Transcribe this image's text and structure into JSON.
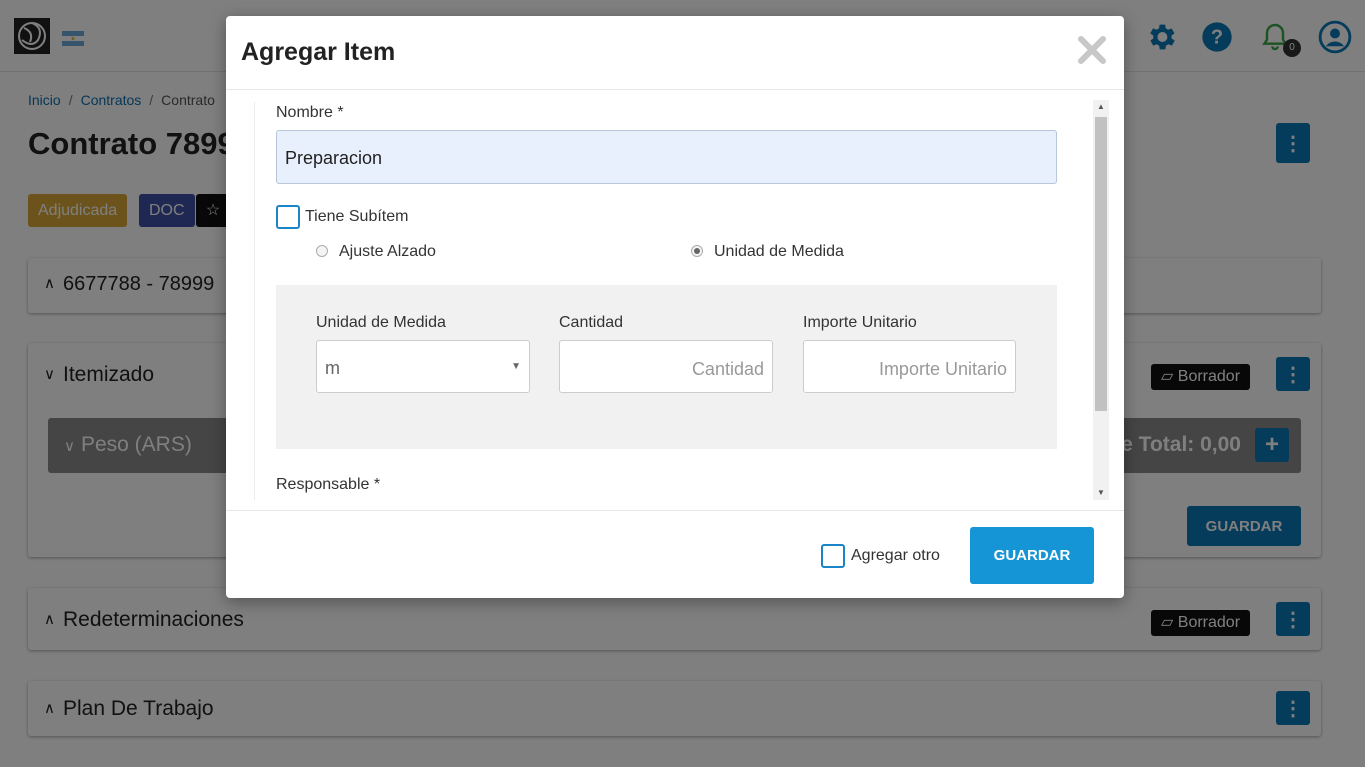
{
  "header": {
    "icons": [
      "app-logo",
      "argentina-flag",
      "gear-icon",
      "help-icon",
      "bell-icon",
      "user-icon"
    ],
    "notification_count": "0"
  },
  "breadcrumb": [
    "Inicio",
    "Contratos",
    "Contrato"
  ],
  "page_title": "Contrato 7899",
  "badges": [
    {
      "label": "Adjudicada",
      "color": "#d8a736"
    },
    {
      "label": "DOC",
      "color": "#3e4ea7"
    }
  ],
  "panels": {
    "contract_summary": "6677788 - 78999",
    "itemizado": "Itemizado",
    "peso_section": "Peso (ARS)",
    "total": "e Total: 0,00",
    "redeterminaciones": "Redeterminaciones",
    "plan_trabajo": "Plan De Trabajo",
    "borrador_label": "Borrador",
    "guardar_label": "GUARDAR"
  },
  "modal": {
    "title": "Agregar Item",
    "nombre_label": "Nombre *",
    "nombre_value": "Preparacion",
    "subitem_label": "Tiene Subítem",
    "radio_ajuste": "Ajuste Alzado",
    "radio_unidad": "Unidad de Medida",
    "selected_radio": "Unidad de Medida",
    "unidad_label": "Unidad de Medida",
    "unidad_value": "m",
    "cantidad_label": "Cantidad",
    "cantidad_placeholder": "Cantidad",
    "importe_label": "Importe Unitario",
    "importe_placeholder": "Importe Unitario",
    "responsable_label": "Responsable *",
    "agregar_otro_label": "Agregar otro",
    "guardar_label": "GUARDAR"
  },
  "colors": {
    "primary": "#0a79b7",
    "modal_button": "#1695d6",
    "checkbox_border": "#1a85c8"
  }
}
